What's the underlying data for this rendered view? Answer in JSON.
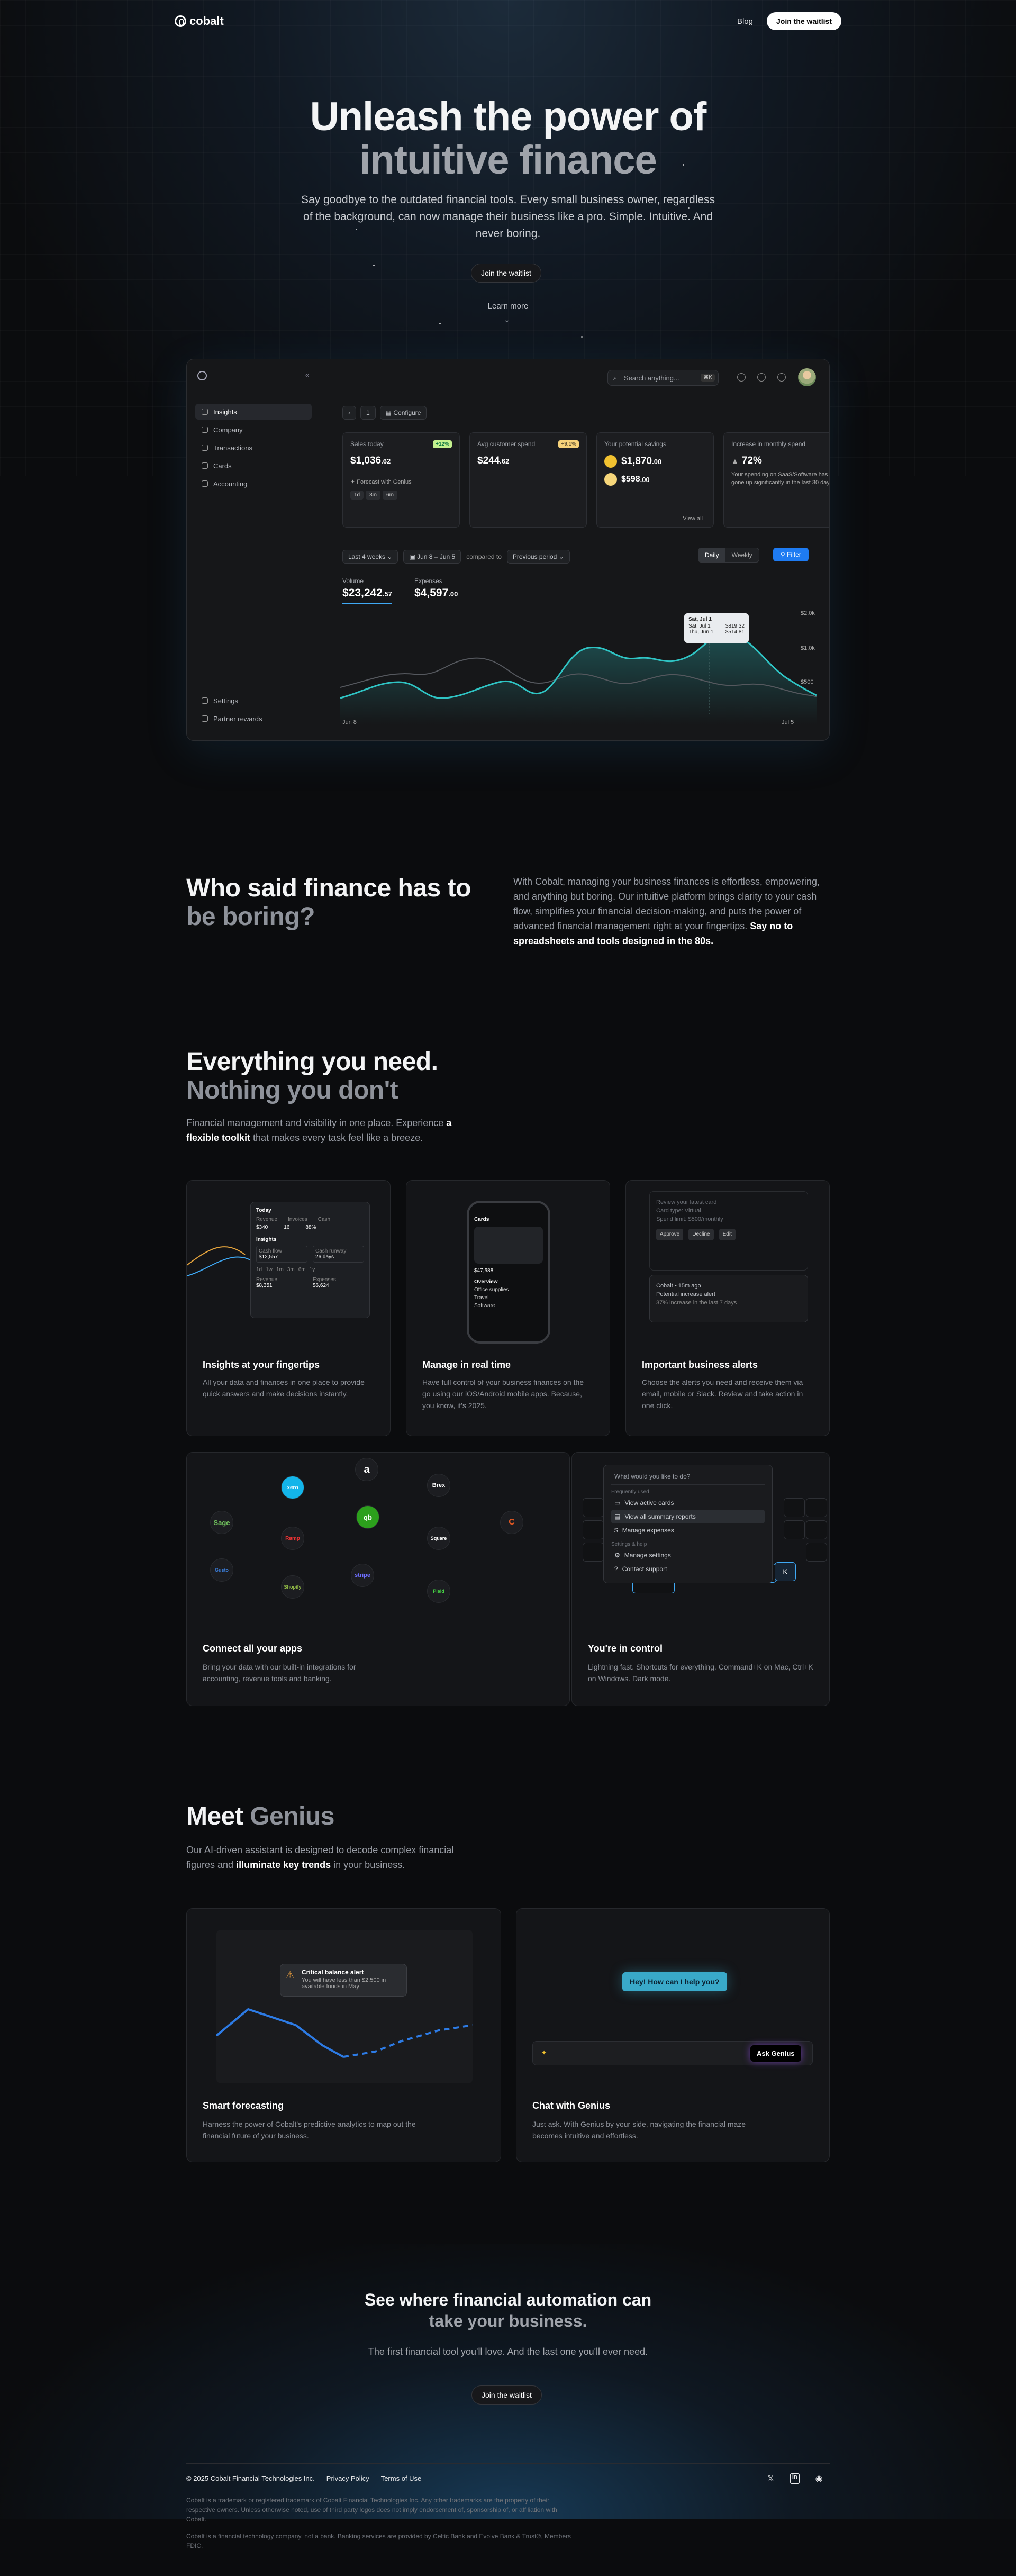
{
  "nav": {
    "brand": "cobalt",
    "blog": "Blog",
    "cta": "Join the waitlist"
  },
  "hero": {
    "title_line1": "Unleash the power of",
    "title_line2": "intuitive finance",
    "subtitle": "Say goodbye to the outdated financial tools. Every small business owner, regardless of the background, can now manage their business like a pro. Simple. Intuitive. And never boring.",
    "cta": "Join the waitlist",
    "learn_more": "Learn more"
  },
  "dashboard": {
    "sidebar": [
      "Insights",
      "Company",
      "Transactions",
      "Cards",
      "Accounting"
    ],
    "sidebar_bottom": [
      "Settings",
      "Partner rewards"
    ],
    "search_placeholder": "Search anything...",
    "search_kbd": "⌘K",
    "crumb_page": "1",
    "configure": "Configure",
    "cards": [
      {
        "label": "Sales today",
        "badge": "+12%",
        "value": "$1,036",
        "cents": ".62",
        "note": "Forecast with Genius",
        "chips": [
          "1d",
          "3m",
          "6m"
        ]
      },
      {
        "label": "Avg customer spend",
        "badge": "+9.1%",
        "value": "$244",
        "cents": ".62"
      },
      {
        "label": "Your potential savings",
        "value1": "$1,870",
        "cents1": ".00",
        "value2": "$598",
        "cents2": ".00",
        "link": "View all"
      },
      {
        "label": "Increase in monthly spend",
        "value": "72%",
        "note": "Your spending on SaaS/Software has gone up significantly in the last 30 days"
      }
    ],
    "range": "Last 4 weeks",
    "dates": "Jun 8 – Jun 5",
    "compared": "compared to",
    "prev": "Previous period",
    "toggle": [
      "Daily",
      "Weekly"
    ],
    "filter": "Filter",
    "volume_label": "Volume",
    "volume_value": "$23,242",
    "volume_cents": ".57",
    "expenses_label": "Expenses",
    "expenses_value": "$4,597",
    "expenses_cents": ".00",
    "tooltip": {
      "title": "Sat, Jul 1",
      "row1_label": "Sat, Jul 1",
      "row1_value": "$819.32",
      "row2_label": "Thu, Jun 1",
      "row2_value": "$514.81"
    },
    "y_ticks": [
      "$2.0k",
      "$1.0k",
      "$500"
    ],
    "x_start": "Jun 8",
    "x_end": "Jul 5"
  },
  "boring": {
    "title_line1": "Who said finance has to",
    "title_line2": "be boring?",
    "text": "With Cobalt, managing your business finances is effortless, empowering, and anything but boring. Our intuitive platform brings clarity to your cash flow, simplifies your financial decision-making, and puts the power of advanced financial management right at your fingertips.",
    "text_bold": "Say no to spreadsheets and tools designed in the 80s."
  },
  "everything": {
    "title_line1": "Everything you need.",
    "title_line2": "Nothing you don't",
    "text_pre": "Financial management and visibility in one place. Experience",
    "text_bold": "a flexible toolkit",
    "text_post": "that makes every task feel like a breeze."
  },
  "features": [
    {
      "title": "Insights at your fingertips",
      "desc": "All your data and finances in one place to provide quick answers and make decisions instantly."
    },
    {
      "title": "Manage in real time",
      "desc": "Have full control of your business finances on the go using our iOS/Android mobile apps. Because, you know, it's 2025."
    },
    {
      "title": "Important business alerts",
      "desc": "Choose the alerts you need and receive them via email, mobile or Slack. Review and take action in one click."
    },
    {
      "title": "Connect all your apps",
      "desc": "Bring your data with our built-in integrations for accounting, revenue tools and banking."
    },
    {
      "title": "You're in control",
      "desc": "Lightning fast. Shortcuts for everything. Command+K on Mac, Ctrl+K on Windows. Dark mode."
    }
  ],
  "insights_vis": {
    "title": "Today",
    "cols": [
      "Revenue",
      "Invoices",
      "Cash"
    ],
    "vals": [
      "$340",
      "16",
      "88%"
    ],
    "sub": "Insights",
    "a_label": "Cash flow",
    "a_val": "$12,557",
    "b_label": "Cash runway",
    "b_val": "26 days",
    "c_label": "Revenue",
    "c_val": "$8,351",
    "d_label": "Expenses",
    "d_val": "$6,624",
    "range": [
      "1d",
      "1w",
      "1m",
      "3m",
      "6m",
      "1y"
    ]
  },
  "phone_vis": {
    "title": "Cards",
    "overview": "Overview",
    "balance": "$47,588",
    "rows": [
      "Office supplies",
      "Travel",
      "Software"
    ]
  },
  "alerts_vis": {
    "approve": "Approve",
    "decline": "Decline",
    "edit": "Edit",
    "from": "Cobalt • 15m ago",
    "l1": "Review your latest card",
    "l2": "Card type: Virtual",
    "l3": "Spend limit: $500/monthly",
    "l4": "Potential increase alert",
    "l5": "37% increase in the last 7 days"
  },
  "integrations": [
    "Sage",
    "stripe",
    "qb",
    "a",
    "Brex",
    "Square",
    "xero",
    "Ramp",
    "Shopify",
    "C",
    "Plaid",
    "Gusto"
  ],
  "cmd": {
    "placeholder": "What would you like to do?",
    "group1": "Frequently used",
    "items1": [
      "View active cards",
      "View all summary reports",
      "Manage expenses"
    ],
    "group2": "Settings & help",
    "items2": [
      "Manage settings",
      "Contact support"
    ],
    "key": "K"
  },
  "genius": {
    "title_a": "Meet",
    "title_b": "Genius",
    "text_pre": "Our AI-driven assistant is designed to decode complex financial figures and",
    "text_bold": "illuminate key trends",
    "text_post": "in your business.",
    "alert_title": "Critical balance alert",
    "alert_text": "You will have less than $2,500 in available funds in May",
    "cards": [
      {
        "title": "Smart forecasting",
        "desc": "Harness the power of Cobalt's predictive analytics to map out the financial future of your business."
      },
      {
        "title": "Chat with Genius",
        "desc": "Just ask. With Genius by your side, navigating the financial maze becomes intuitive and effortless."
      }
    ],
    "bubble": "Hey! How can I help you?",
    "ask": "Ask Genius"
  },
  "automation": {
    "title_line1": "See where financial automation can",
    "title_line2": "take your business.",
    "text": "The first financial tool you'll love. And the last one you'll ever need.",
    "cta": "Join the waitlist"
  },
  "footer": {
    "copy": "© 2025 Cobalt Financial Technologies Inc.",
    "privacy": "Privacy Policy",
    "terms": "Terms of Use",
    "legal1": "Cobalt is a trademark or registered trademark of Cobalt Financial Technologies Inc. Any other trademarks are the property of their respective owners. Unless otherwise noted, use of third party logos does not imply endorsement of, sponsorship of, or affiliation with Cobalt.",
    "legal2": "Cobalt is a financial technology company, not a bank. Banking services are provided by Celtic Bank and Evolve Bank & Trust®, Members FDIC."
  }
}
